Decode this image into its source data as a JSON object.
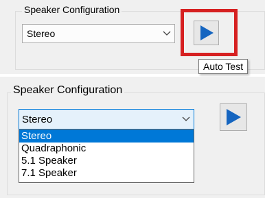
{
  "top_panel": {
    "group_title": "Speaker Configuration",
    "combo_value": "Stereo",
    "play_icon": "play-triangle-icon",
    "tooltip": "Auto Test",
    "highlight_color": "#d62021"
  },
  "bottom_panel": {
    "group_title": "Speaker Configuration",
    "combo_value": "Stereo",
    "play_icon": "play-triangle-icon",
    "options": [
      {
        "label": "Stereo",
        "selected": true
      },
      {
        "label": "Quadraphonic",
        "selected": false
      },
      {
        "label": "5.1 Speaker",
        "selected": false
      },
      {
        "label": "7.1 Speaker",
        "selected": false
      }
    ]
  },
  "colors": {
    "play_blue": "#1565c0",
    "selection_blue": "#0078d7",
    "panel_bg": "#f0f0f0"
  }
}
